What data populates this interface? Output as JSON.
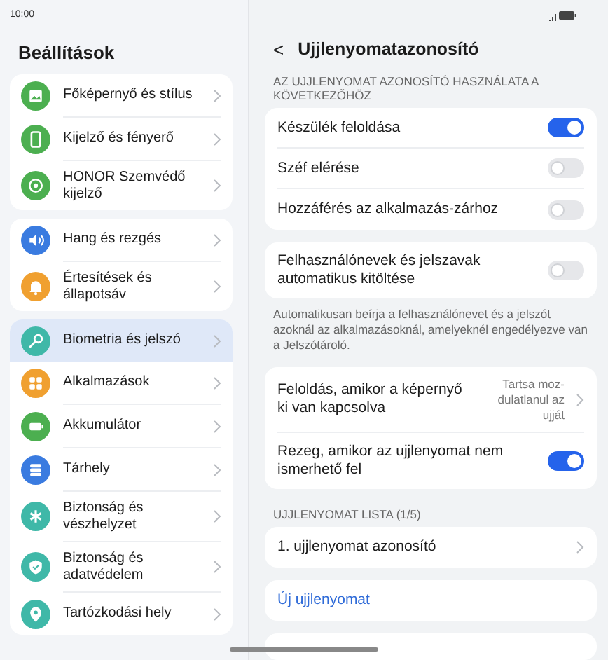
{
  "status_bar": {
    "time": "10:00"
  },
  "sidebar": {
    "title": "Beállítások",
    "groups": [
      {
        "items": [
          {
            "label": "Főképernyő és stílus",
            "kind": "image",
            "color": "#4caf50",
            "selected": false
          },
          {
            "label": "Kijelző és fényerő",
            "kind": "phone",
            "color": "#4caf50",
            "selected": false
          },
          {
            "label": "HONOR Szemvédő kijelző",
            "kind": "eye",
            "color": "#4caf50",
            "selected": false
          }
        ]
      },
      {
        "items": [
          {
            "label": "Hang és rezgés",
            "kind": "sound",
            "color": "#3a7be0",
            "selected": false
          },
          {
            "label": "Értesítések és állapotsáv",
            "kind": "bell",
            "color": "#f0a030",
            "selected": false
          }
        ]
      },
      {
        "items": [
          {
            "label": "Biometria és jelszó",
            "kind": "key",
            "color": "#3fb8a8",
            "selected": true
          },
          {
            "label": "Alkalmazások",
            "kind": "apps",
            "color": "#f0a030",
            "selected": false
          },
          {
            "label": "Akkumulátor",
            "kind": "battery",
            "color": "#4caf50",
            "selected": false
          },
          {
            "label": "Tárhely",
            "kind": "storage",
            "color": "#3a7be0",
            "selected": false
          },
          {
            "label": "Biztonság és vészhelyzet",
            "kind": "asterisk",
            "color": "#3fb8a8",
            "selected": false
          },
          {
            "label": "Biztonság és adatvédelem",
            "kind": "shield",
            "color": "#3fb8a8",
            "selected": false
          },
          {
            "label": "Tartózkodási hely",
            "kind": "pin",
            "color": "#3fb8a8",
            "selected": false
          }
        ]
      }
    ]
  },
  "detail": {
    "back": "<",
    "title": "Ujjlenyomatazonosító",
    "blocks": [
      {
        "kind": "label",
        "text": "AZ UJJLENYOMAT AZONOSÍTÓ HASZNÁLATA A KÖVETKEZŐHÖZ"
      },
      {
        "kind": "card",
        "rows": [
          {
            "kind": "toggle",
            "label": "Készülék feloldása",
            "on": true
          },
          {
            "kind": "toggle",
            "label": "Széf elérése",
            "on": false
          },
          {
            "kind": "toggle",
            "label": "Hozzáférés az alkalmazás-zárhoz",
            "on": false
          }
        ]
      },
      {
        "kind": "card",
        "rows": [
          {
            "kind": "toggle",
            "label": "Felhasználónevek és jelszavak automatikus kitöltése",
            "on": false
          }
        ]
      },
      {
        "kind": "note",
        "text": "Automatikusan beírja a felhasználónevet és a jelszót azoknál az alkalmazásoknál, amelyeknél engedélyezve van a Jelszótároló."
      },
      {
        "kind": "card",
        "rows": [
          {
            "kind": "value",
            "label": "Feloldás, amikor a képernyő ki van kapcsolva",
            "value": "Tartsa moz-dulatlanul az ujját"
          },
          {
            "kind": "toggle",
            "label": "Rezeg, amikor az ujjlenyomat nem ismerhető fel",
            "on": true
          }
        ]
      },
      {
        "kind": "label",
        "text": "UJJLENYOMAT LISTA (1/5)"
      },
      {
        "kind": "card",
        "rows": [
          {
            "kind": "link",
            "label": "1. ujjlenyomat azonosító"
          }
        ]
      },
      {
        "kind": "card",
        "rows": [
          {
            "kind": "action",
            "label": "Új ujjlenyomat"
          }
        ]
      },
      {
        "kind": "stub"
      }
    ]
  }
}
